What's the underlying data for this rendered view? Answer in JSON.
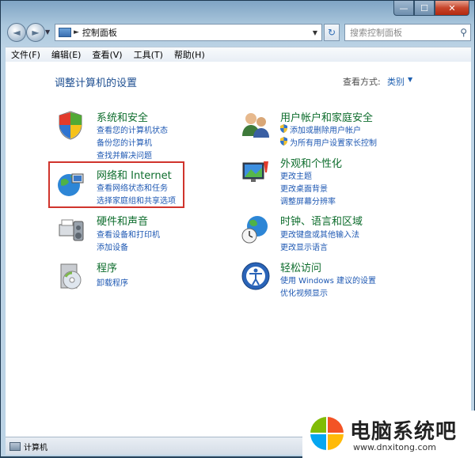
{
  "window": {
    "caption": {
      "minimize": "—",
      "maximize": "☐",
      "close": "✕"
    }
  },
  "nav": {
    "back": "◄",
    "forward": "►",
    "address": "控制面板",
    "search_placeholder": "搜索控制面板"
  },
  "menu": [
    "文件(F)",
    "编辑(E)",
    "查看(V)",
    "工具(T)",
    "帮助(H)"
  ],
  "page": {
    "title": "调整计算机的设置",
    "view_by_label": "查看方式:",
    "view_by_value": "类别"
  },
  "categories_left": [
    {
      "title": "系统和安全",
      "icon": "shield-icon",
      "links": [
        "查看您的计算机状态",
        "备份您的计算机",
        "查找并解决问题"
      ]
    },
    {
      "title": "网络和 Internet",
      "icon": "network-globe-icon",
      "links": [
        "查看网络状态和任务",
        "选择家庭组和共享选项"
      ]
    },
    {
      "title": "硬件和声音",
      "icon": "printer-speaker-icon",
      "links": [
        "查看设备和打印机",
        "添加设备"
      ]
    },
    {
      "title": "程序",
      "icon": "program-disk-icon",
      "links": [
        "卸载程序"
      ]
    }
  ],
  "categories_right": [
    {
      "title": "用户帐户和家庭安全",
      "icon": "users-icon",
      "links": [
        "添加或删除用户帐户",
        "为所有用户设置家长控制"
      ]
    },
    {
      "title": "外观和个性化",
      "icon": "monitor-paint-icon",
      "links": [
        "更改主题",
        "更改桌面背景",
        "调整屏幕分辨率"
      ]
    },
    {
      "title": "时钟、语言和区域",
      "icon": "clock-globe-icon",
      "links": [
        "更改键盘或其他输入法",
        "更改显示语言"
      ]
    },
    {
      "title": "轻松访问",
      "icon": "ease-of-access-icon",
      "links": [
        "使用 Windows 建议的设置",
        "优化视频显示"
      ]
    }
  ],
  "status": {
    "text": "计算机"
  },
  "watermark": {
    "name": "电脑系统吧",
    "url": "www.dnxitong.com"
  },
  "colors": {
    "link": "#1f59b3",
    "category": "#0e6d2d",
    "highlight": "#d0342c"
  }
}
